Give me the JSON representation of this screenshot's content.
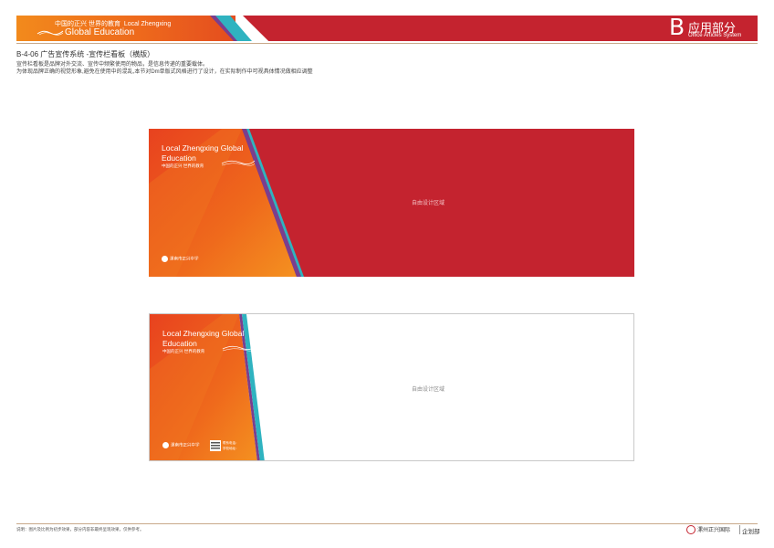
{
  "header": {
    "cn_slogan": "中国的正兴  世界的教育",
    "en_line1": "Local Zhengxing",
    "en_line2": "Global Education",
    "section_letter": "B",
    "section_title": "应用部分",
    "section_subtitle": "Office Articles System"
  },
  "page": {
    "title": "B-4-06  广告宣传系统 -宣传栏看板（横版）",
    "desc_line1": "宣传栏看板是品牌对外交流、宣传中频繁使用的物品，是信息传递的重要载体。",
    "desc_line2": "为体现品牌正确的视觉形象,避免在使用中的混乱,本节对Dm单版式风格进行了设计，在实际制作中可视具体情况做相应调整"
  },
  "banners": [
    {
      "variant": "red",
      "slogan_en_1": "Local Zhengxing Global",
      "slogan_en_2": "Education",
      "slogan_cn": "中国的正兴  世界的教育",
      "logo_text": "漯南市正兴中学",
      "free_area_label": "自由设计区域"
    },
    {
      "variant": "white",
      "slogan_en_1": "Local Zhengxing Global",
      "slogan_en_2": "Education",
      "slogan_cn": "中国的正兴  世界的教育",
      "logo_text": "漯南市正兴中学",
      "contact_1": "联系电话：",
      "contact_2": "学校地址：",
      "free_area_label": "自由设计区域"
    }
  ],
  "footer": {
    "note": "说明：图片及比例为初步效果，部分内容非最终呈现效果，仅供参考。",
    "logo_text": "漯州正兴国际",
    "dept": "企划部"
  },
  "colors": {
    "brand_red": "#c4232f",
    "brand_orange": "#ee6a1c",
    "accent_teal": "#2fb3c0",
    "accent_purple": "#7a3e8e"
  }
}
